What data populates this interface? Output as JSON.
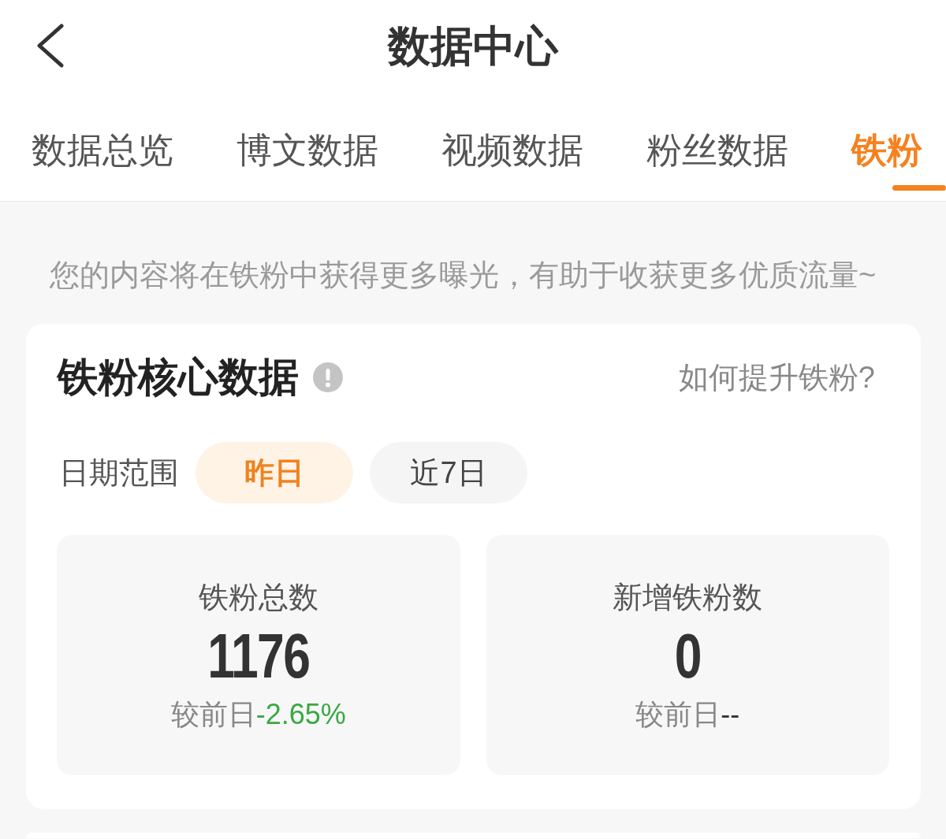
{
  "header": {
    "title": "数据中心"
  },
  "tabs": [
    {
      "label": "数据总览",
      "selected": false
    },
    {
      "label": "博文数据",
      "selected": false
    },
    {
      "label": "视频数据",
      "selected": false
    },
    {
      "label": "粉丝数据",
      "selected": false
    },
    {
      "label": "铁粉",
      "selected": true
    }
  ],
  "hint": "您的内容将在铁粉中获得更多曝光，有助于收获更多优质流量~",
  "core_card": {
    "title": "铁粉核心数据",
    "help_link": "如何提升铁粉?",
    "date_range": {
      "label": "日期范围",
      "options": [
        {
          "label": "昨日",
          "selected": true
        },
        {
          "label": "近7日",
          "selected": false
        }
      ]
    },
    "stats": [
      {
        "label": "铁粉总数",
        "value": "1176",
        "compare_label": "较前日",
        "change": "-2.65%",
        "color": "#3aa845"
      },
      {
        "label": "新增铁粉数",
        "value": "0",
        "compare_label": "较前日",
        "change": "--",
        "color": "#333333"
      }
    ]
  }
}
